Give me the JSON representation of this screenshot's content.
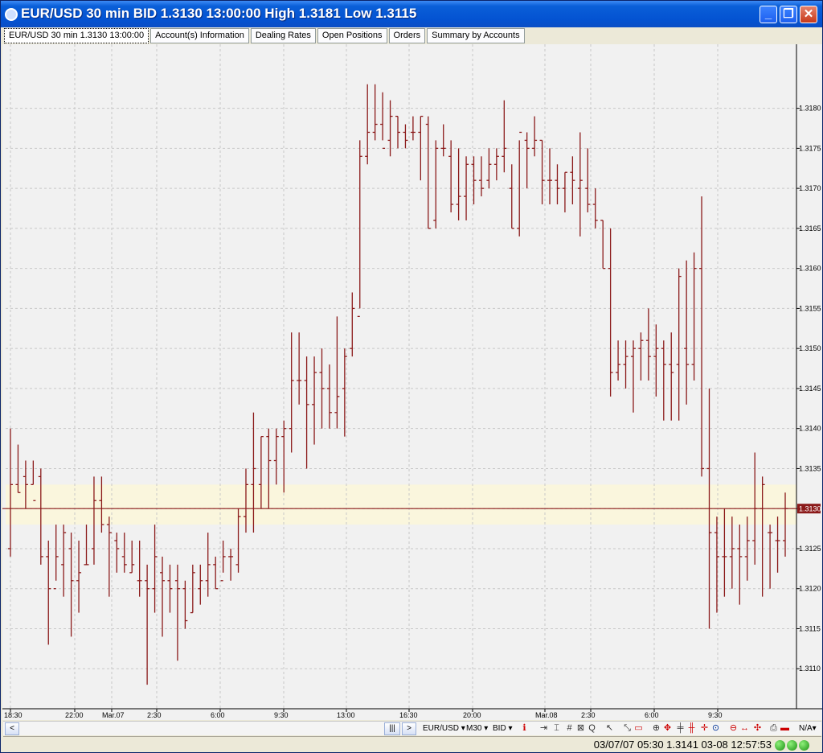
{
  "window": {
    "title": "EUR/USD 30 min BID 1.3130 13:00:00 High 1.3181 Low 1.3115"
  },
  "tabs": [
    {
      "label": "EUR/USD 30 min 1.3130 13:00:00",
      "active": true
    },
    {
      "label": "Account(s) Information"
    },
    {
      "label": "Dealing Rates"
    },
    {
      "label": "Open Positions"
    },
    {
      "label": "Orders"
    },
    {
      "label": "Summary by Accounts"
    }
  ],
  "toolbar": {
    "symbol": "EUR/USD",
    "timeframe": "M30",
    "price_type": "BID",
    "na_label": "N/A",
    "icons": [
      "indicator-icon",
      "goto-end-icon",
      "crosshair-icon",
      "grid-icon",
      "q-icon",
      "cursor-icon",
      "select-icon",
      "zoom-in-icon",
      "move-icon",
      "add-line-icon",
      "fib-icon",
      "zoom-icon",
      "delete-icon",
      "print-icon"
    ]
  },
  "status": {
    "text": "03/07/07 05:30   1.3141   03-08 12:57:53"
  },
  "colors": {
    "bar": "#8b1a1a",
    "current_price": "#8b1a1a",
    "band": "#faf6dd",
    "grid": "#c8c8c8"
  },
  "chart_data": {
    "type": "ohlc",
    "title": "EUR/USD 30 min BID",
    "current_price": 1.313,
    "current_price_label": "1.3130",
    "band": [
      1.3128,
      1.3133
    ],
    "ylim": [
      1.3105,
      1.3188
    ],
    "y_ticks": [
      "1.3110",
      "1.3115",
      "1.3120",
      "1.3125",
      "1.3130",
      "1.3135",
      "1.3140",
      "1.3145",
      "1.3150",
      "1.3155",
      "1.3160",
      "1.3165",
      "1.3170",
      "1.3175",
      "1.3180"
    ],
    "x_ticks": [
      "18:30",
      "22:00",
      "Mar.07",
      "2:30",
      "6:00",
      "9:30",
      "13:00",
      "16:30",
      "20:00",
      "Mar.08",
      "2:30",
      "6:00",
      "9:30"
    ],
    "bars": [
      [
        1.3125,
        1.314,
        1.3124,
        1.3133
      ],
      [
        1.3133,
        1.3138,
        1.3132,
        1.3132
      ],
      [
        1.3134,
        1.3136,
        1.313,
        1.3133
      ],
      [
        1.3133,
        1.3136,
        1.3133,
        1.3131
      ],
      [
        1.3134,
        1.3135,
        1.3123,
        1.3124
      ],
      [
        1.3124,
        1.3126,
        1.3113,
        1.312
      ],
      [
        1.312,
        1.3128,
        1.3121,
        1.3124
      ],
      [
        1.3123,
        1.3128,
        1.3119,
        1.3127
      ],
      [
        1.3125,
        1.3127,
        1.3114,
        1.3121
      ],
      [
        1.3121,
        1.3126,
        1.3117,
        1.3122
      ],
      [
        1.3123,
        1.3128,
        1.3123,
        1.3123
      ],
      [
        1.3125,
        1.3134,
        1.3123,
        1.3131
      ],
      [
        1.3131,
        1.3134,
        1.3127,
        1.3128
      ],
      [
        1.3128,
        1.3129,
        1.3119,
        1.3127
      ],
      [
        1.3126,
        1.3127,
        1.3122,
        1.3125
      ],
      [
        1.3124,
        1.3127,
        1.3122,
        1.3123
      ],
      [
        1.3122,
        1.3126,
        1.3122,
        1.3123
      ],
      [
        1.3121,
        1.3126,
        1.3119,
        1.3121
      ],
      [
        1.3121,
        1.3123,
        1.3108,
        1.312
      ],
      [
        1.312,
        1.3128,
        1.3117,
        1.3124
      ],
      [
        1.3122,
        1.3124,
        1.3114,
        1.3121
      ],
      [
        1.3121,
        1.3123,
        1.3117,
        1.312
      ],
      [
        1.3121,
        1.3123,
        1.3111,
        1.312
      ],
      [
        1.312,
        1.3121,
        1.3115,
        1.3116
      ],
      [
        1.3117,
        1.3123,
        1.3117,
        1.3122
      ],
      [
        1.312,
        1.3123,
        1.3118,
        1.3121
      ],
      [
        1.3121,
        1.3127,
        1.3119,
        1.3123
      ],
      [
        1.3123,
        1.3124,
        1.312,
        1.312
      ],
      [
        1.3121,
        1.3126,
        1.3122,
        1.3124
      ],
      [
        1.3124,
        1.3125,
        1.3121,
        1.3124
      ],
      [
        1.3123,
        1.313,
        1.3122,
        1.3129
      ],
      [
        1.3129,
        1.3135,
        1.3127,
        1.3133
      ],
      [
        1.3133,
        1.3142,
        1.3127,
        1.3135
      ],
      [
        1.3133,
        1.3139,
        1.313,
        1.3139
      ],
      [
        1.3139,
        1.314,
        1.313,
        1.3136
      ],
      [
        1.3136,
        1.314,
        1.3133,
        1.3139
      ],
      [
        1.3139,
        1.3141,
        1.3132,
        1.314
      ],
      [
        1.314,
        1.3152,
        1.3137,
        1.3146
      ],
      [
        1.3146,
        1.3152,
        1.3143,
        1.3146
      ],
      [
        1.3146,
        1.3149,
        1.3135,
        1.3143
      ],
      [
        1.3143,
        1.3149,
        1.3138,
        1.3147
      ],
      [
        1.3147,
        1.315,
        1.314,
        1.3145
      ],
      [
        1.3145,
        1.3148,
        1.314,
        1.3142
      ],
      [
        1.3142,
        1.3154,
        1.314,
        1.3144
      ],
      [
        1.3145,
        1.315,
        1.3139,
        1.3149
      ],
      [
        1.315,
        1.3157,
        1.3149,
        1.3155
      ],
      [
        1.3154,
        1.3176,
        1.3155,
        1.3174
      ],
      [
        1.3174,
        1.3183,
        1.3173,
        1.3177
      ],
      [
        1.3177,
        1.3183,
        1.3176,
        1.3178
      ],
      [
        1.3178,
        1.3182,
        1.3176,
        1.3175
      ],
      [
        1.3176,
        1.3181,
        1.3174,
        1.3179
      ],
      [
        1.3179,
        1.3179,
        1.3175,
        1.3177
      ],
      [
        1.3177,
        1.3178,
        1.3175,
        1.3176
      ],
      [
        1.3177,
        1.3179,
        1.3176,
        1.3177
      ],
      [
        1.3177,
        1.3179,
        1.3171,
        1.3179
      ],
      [
        1.3178,
        1.3179,
        1.3165,
        1.3165
      ],
      [
        1.3166,
        1.3176,
        1.3165,
        1.3175
      ],
      [
        1.3175,
        1.3178,
        1.3174,
        1.3175
      ],
      [
        1.3174,
        1.3176,
        1.3167,
        1.3168
      ],
      [
        1.3168,
        1.3175,
        1.3166,
        1.3169
      ],
      [
        1.3169,
        1.3174,
        1.3166,
        1.3173
      ],
      [
        1.3173,
        1.3174,
        1.3168,
        1.3171
      ],
      [
        1.3171,
        1.3174,
        1.3169,
        1.317
      ],
      [
        1.3171,
        1.3175,
        1.317,
        1.3173
      ],
      [
        1.3173,
        1.3175,
        1.3171,
        1.3174
      ],
      [
        1.3174,
        1.3181,
        1.3172,
        1.3175
      ],
      [
        1.317,
        1.3173,
        1.3165,
        1.3165
      ],
      [
        1.3165,
        1.3176,
        1.3164,
        1.3177
      ],
      [
        1.3176,
        1.3177,
        1.317,
        1.3175
      ],
      [
        1.3175,
        1.3179,
        1.3174,
        1.3176
      ],
      [
        1.3176,
        1.3176,
        1.3168,
        1.3171
      ],
      [
        1.3171,
        1.3175,
        1.3168,
        1.3171
      ],
      [
        1.3171,
        1.3173,
        1.3168,
        1.317
      ],
      [
        1.317,
        1.3172,
        1.3167,
        1.3172
      ],
      [
        1.3172,
        1.3174,
        1.3168,
        1.3171
      ],
      [
        1.317,
        1.3177,
        1.3164,
        1.3171
      ],
      [
        1.317,
        1.3175,
        1.3167,
        1.3168
      ],
      [
        1.3168,
        1.317,
        1.3165,
        1.3166
      ],
      [
        1.3166,
        1.3166,
        1.316,
        1.316
      ],
      [
        1.316,
        1.3165,
        1.3144,
        1.3147
      ],
      [
        1.3147,
        1.3151,
        1.3146,
        1.3148
      ],
      [
        1.3148,
        1.3151,
        1.3145,
        1.3149
      ],
      [
        1.3149,
        1.3151,
        1.3142,
        1.315
      ],
      [
        1.315,
        1.3152,
        1.3146,
        1.3151
      ],
      [
        1.3151,
        1.3155,
        1.3146,
        1.3149
      ],
      [
        1.3149,
        1.3153,
        1.3144,
        1.315
      ],
      [
        1.315,
        1.3151,
        1.3141,
        1.3148
      ],
      [
        1.3148,
        1.3152,
        1.3141,
        1.3147
      ],
      [
        1.3148,
        1.316,
        1.3141,
        1.3159
      ],
      [
        1.315,
        1.3161,
        1.3143,
        1.3148
      ],
      [
        1.3148,
        1.3162,
        1.3146,
        1.316
      ],
      [
        1.316,
        1.3169,
        1.3134,
        1.3135
      ],
      [
        1.3135,
        1.3145,
        1.3115,
        1.3127
      ],
      [
        1.3127,
        1.3129,
        1.3117,
        1.3124
      ],
      [
        1.3124,
        1.313,
        1.3119,
        1.3124
      ],
      [
        1.3124,
        1.3129,
        1.312,
        1.3125
      ],
      [
        1.3125,
        1.3128,
        1.3118,
        1.3124
      ],
      [
        1.3124,
        1.3129,
        1.3121,
        1.3126
      ],
      [
        1.3126,
        1.3137,
        1.3123,
        1.313
      ],
      [
        1.313,
        1.3134,
        1.3119,
        1.3133
      ],
      [
        1.3127,
        1.3128,
        1.312,
        1.3127
      ],
      [
        1.3126,
        1.3129,
        1.3122,
        1.3126
      ],
      [
        1.3126,
        1.3132,
        1.3124,
        1.313
      ]
    ]
  }
}
